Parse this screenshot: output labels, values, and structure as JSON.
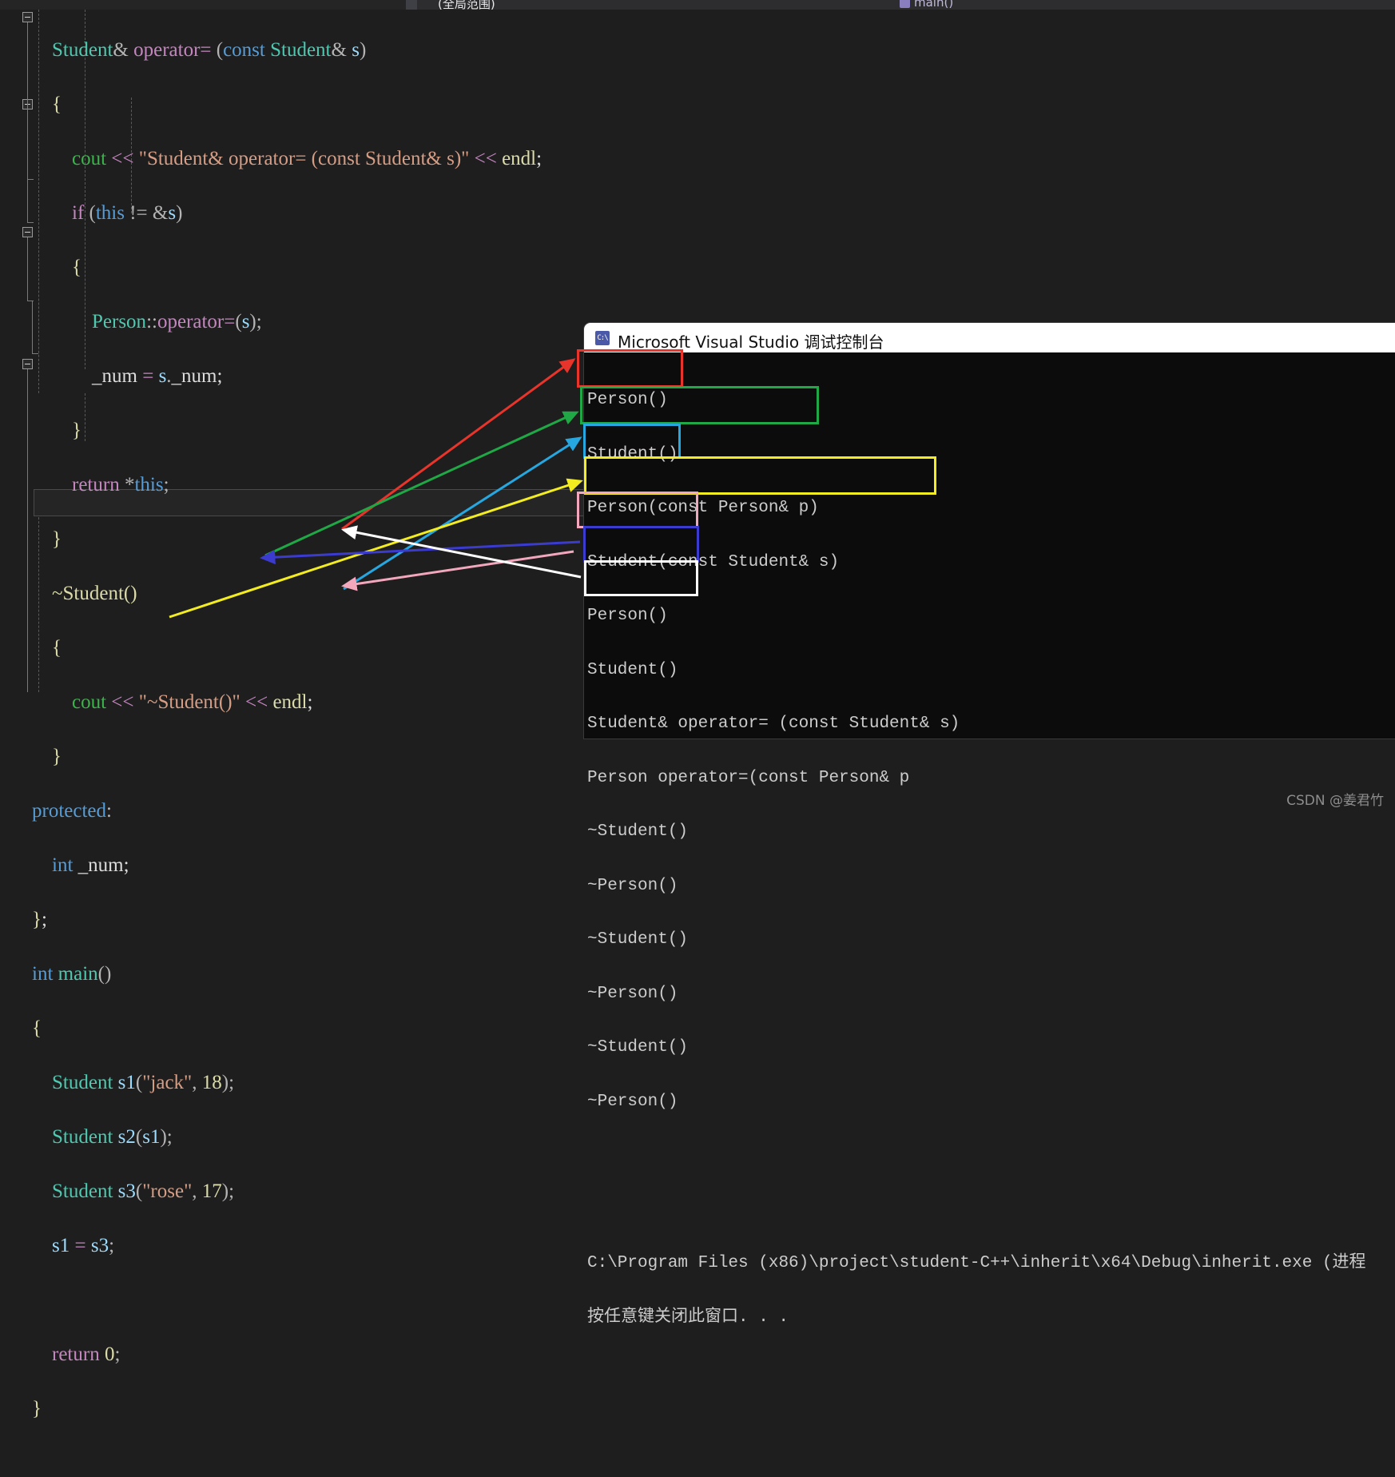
{
  "window": {
    "tab_label": "(全局范围)",
    "nav_member": "main()"
  },
  "editor": {
    "language": "cpp",
    "code_lines": [
      "    Student& operator= (const Student& s)",
      "    {",
      "        cout << \"Student& operator= (const Student& s)\" << endl;",
      "        if (this != &s)",
      "        {",
      "            Person::operator=(s);",
      "            _num = s._num;",
      "        }",
      "        return *this;",
      "    }",
      "    ~Student()",
      "    {",
      "        cout << \"~Student()\" << endl;",
      "    }",
      "protected:",
      "    int _num;",
      "};",
      "int main()",
      "{",
      "    Student s1(\"jack\", 18);",
      "    Student s2(s1);",
      "    Student s3(\"rose\", 17);",
      "    s1 = s3;",
      "",
      "    return 0;",
      "}"
    ]
  },
  "console": {
    "title": "Microsoft Visual Studio 调试控制台",
    "icon": "console-app-icon",
    "output_lines": [
      "Person()",
      "Student()",
      "Person(const Person& p)",
      "Student(const Student& s)",
      "Person()",
      "Student()",
      "Student& operator= (const Student& s)",
      "Person operator=(const Person& p",
      "~Student()",
      "~Person()",
      "~Student()",
      "~Person()",
      "~Student()",
      "~Person()",
      "",
      "",
      "C:\\Program Files (x86)\\project\\student-C++\\inherit\\x64\\Debug\\inherit.exe (进程",
      "按任意键关闭此窗口. . ."
    ]
  },
  "annotations": {
    "boxes": [
      {
        "name": "box-red",
        "color": "#e8342a",
        "label_lines": [
          "Person()",
          "Student()"
        ]
      },
      {
        "name": "box-green",
        "color": "#1fa845",
        "label_lines": [
          "Person(const Person& p)",
          "Student(const Student& s)"
        ]
      },
      {
        "name": "box-cyan",
        "color": "#27a7e0",
        "label_lines": [
          "Person()",
          "Student()"
        ]
      },
      {
        "name": "box-yellow",
        "color": "#f2ec20",
        "label_lines": [
          "Student& operator= (const Student& s)",
          "Person operator=(const Person& p"
        ]
      },
      {
        "name": "box-pink",
        "color": "#f3a7bd",
        "label_lines": [
          "~Student()",
          "~Person()"
        ]
      },
      {
        "name": "box-blue",
        "color": "#3b3bd0",
        "label_lines": [
          "~Student()",
          "~Person()"
        ]
      },
      {
        "name": "box-white",
        "color": "#ffffff",
        "label_lines": [
          "~Student()",
          "~Person()"
        ]
      }
    ],
    "arrows": [
      {
        "name": "arrow-red",
        "color": "#e8342a",
        "from_code": "Student s1(\"jack\", 18);",
        "to_box": "box-red"
      },
      {
        "name": "arrow-green",
        "color": "#1fa845",
        "from_code": "Student s2(s1);",
        "to_box": "box-green"
      },
      {
        "name": "arrow-cyan",
        "color": "#27a7e0",
        "from_code": "Student s3(\"rose\", 17);",
        "to_box": "box-cyan"
      },
      {
        "name": "arrow-yellow",
        "color": "#f2ec20",
        "from_code": "s1 = s3;",
        "to_box": "box-yellow"
      },
      {
        "name": "arrow-pink",
        "color": "#f3a7bd",
        "from_code": "Student s3(\"rose\", 17);",
        "to_box": "box-pink"
      },
      {
        "name": "arrow-blue",
        "color": "#3b3bd0",
        "from_code": "Student s2(s1);",
        "to_box": "box-blue"
      },
      {
        "name": "arrow-white",
        "color": "#ffffff",
        "from_code": "Student s1(\"jack\", 18);",
        "to_box": "box-white"
      }
    ]
  },
  "watermark": "CSDN @姜君竹"
}
